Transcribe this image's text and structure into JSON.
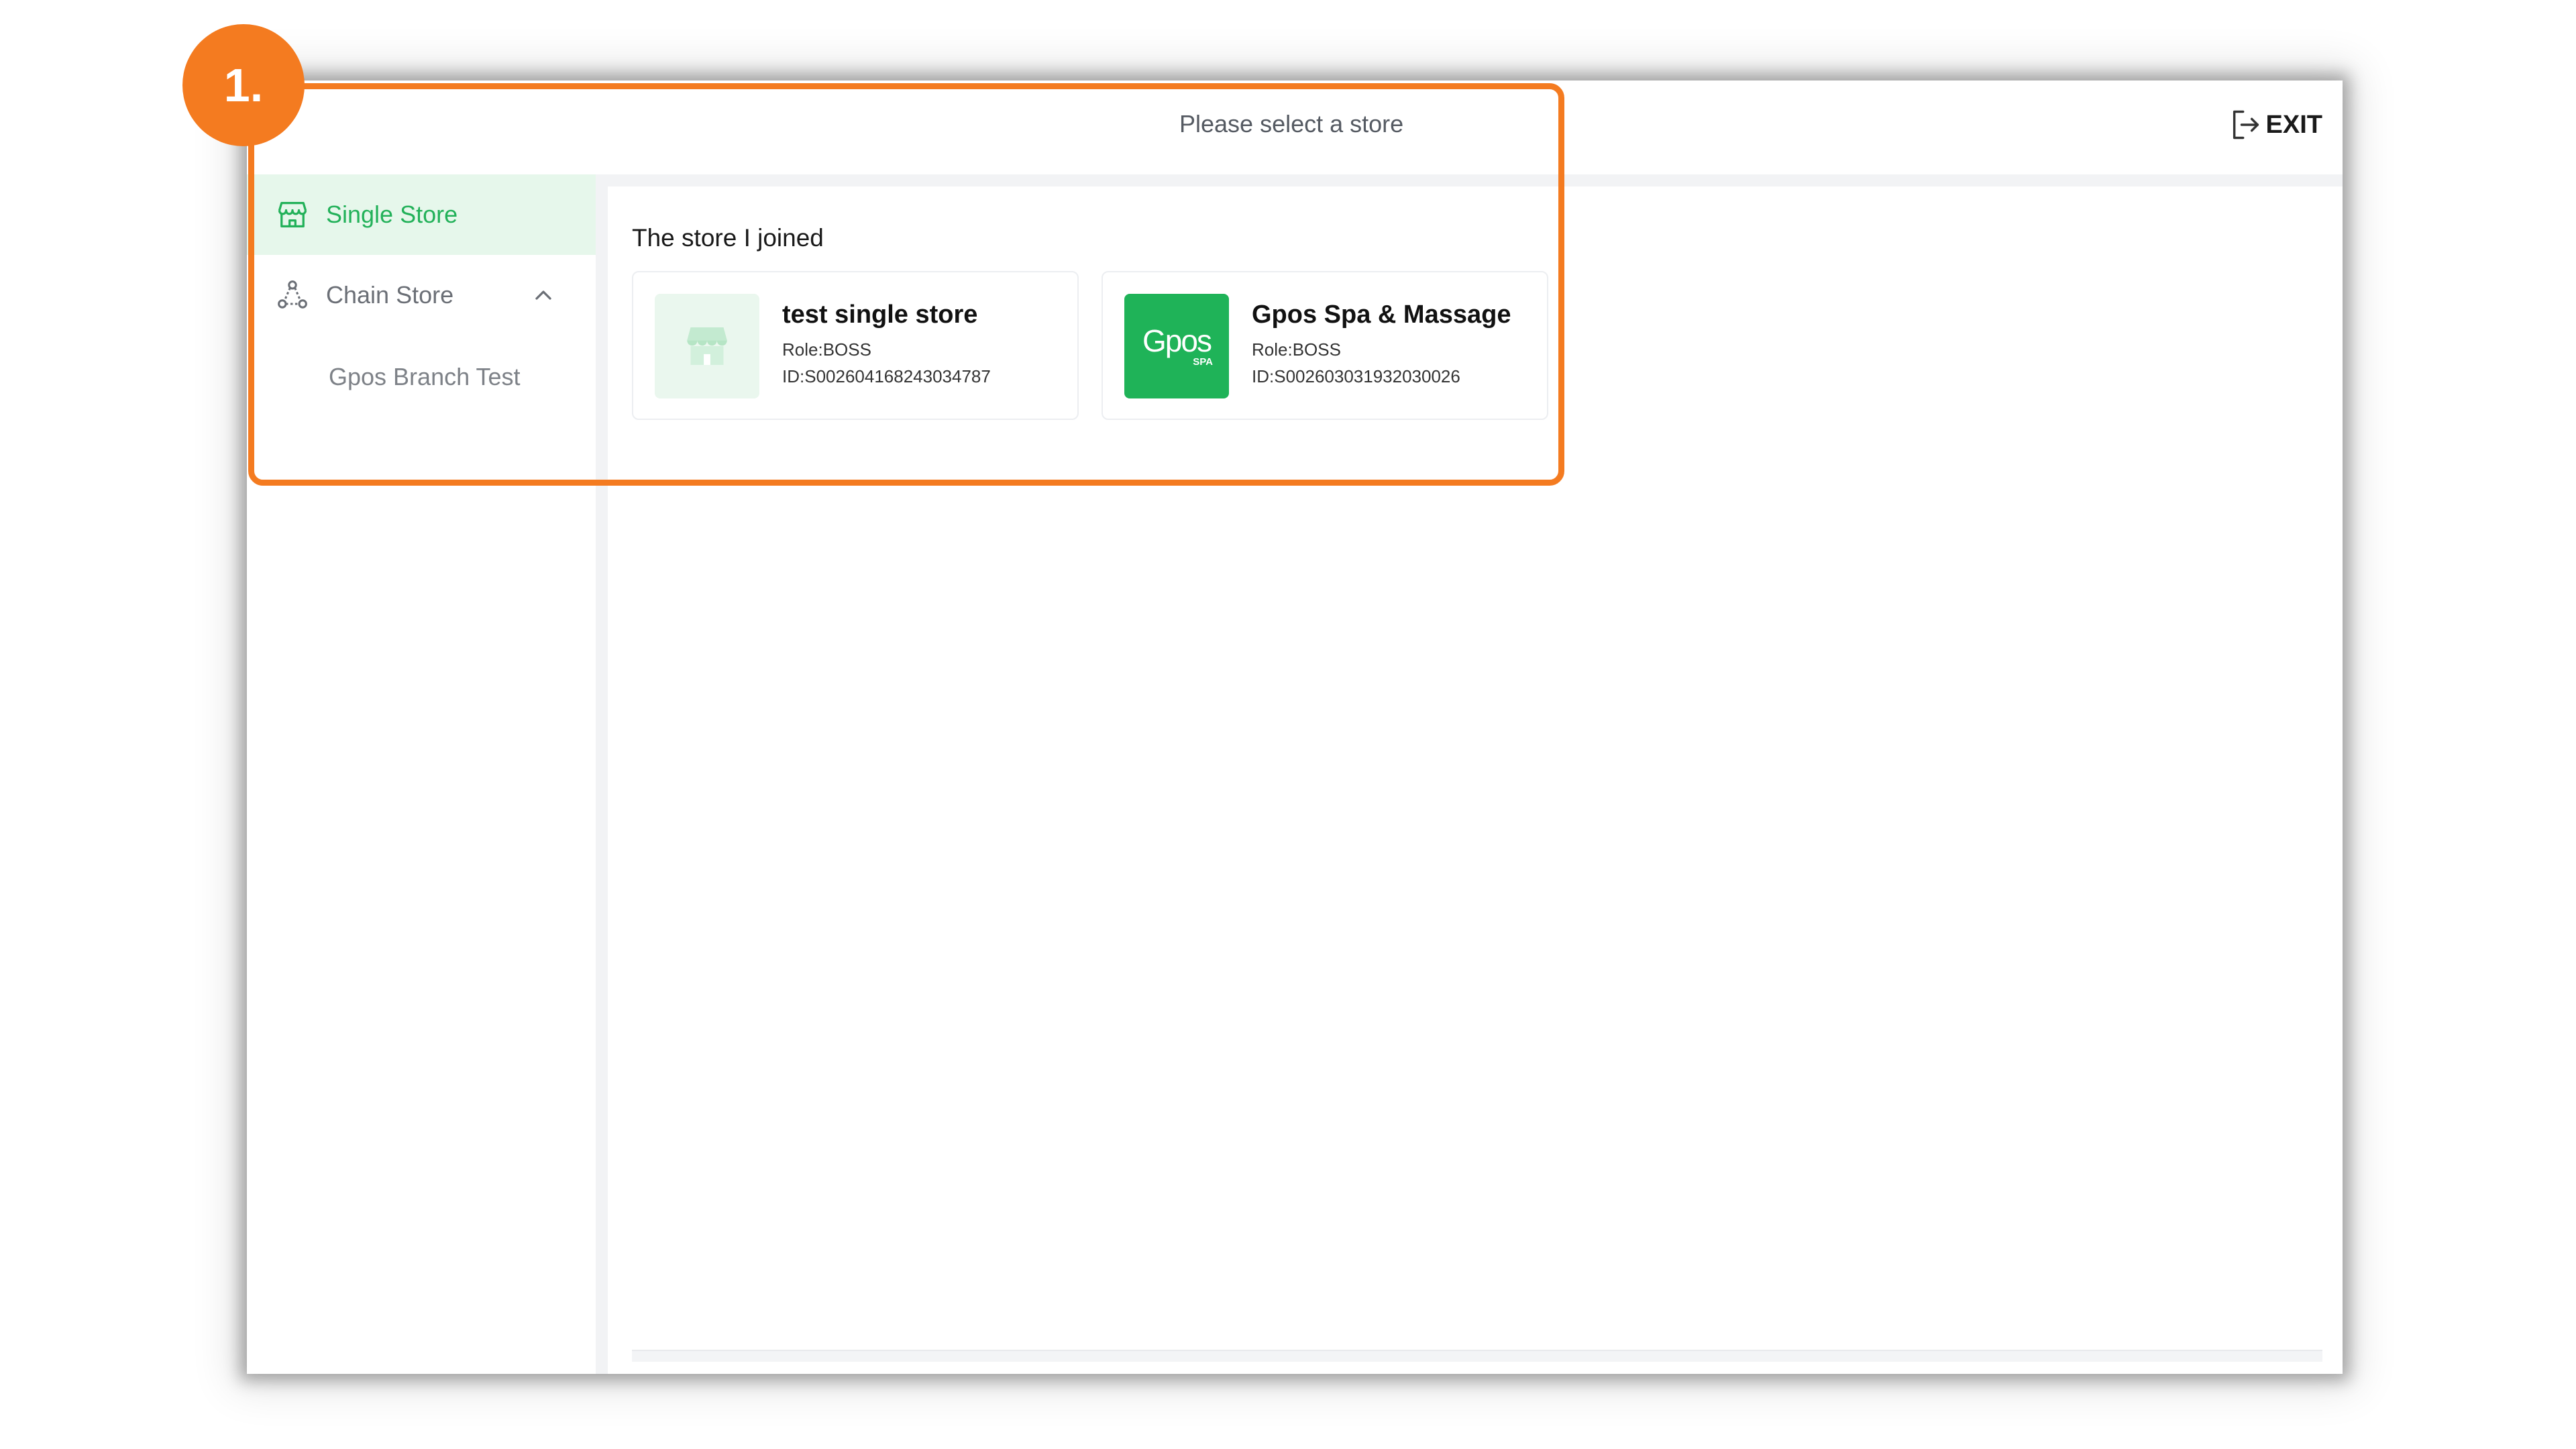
{
  "header": {
    "title": "Please select a store",
    "exit_label": "EXIT"
  },
  "sidebar": {
    "items": [
      {
        "label": "Single Store",
        "icon": "storefront-icon",
        "active": true
      },
      {
        "label": "Chain Store",
        "icon": "chain-network-icon",
        "expanded": true,
        "children": [
          {
            "label": "Gpos Branch Test"
          }
        ]
      }
    ]
  },
  "main": {
    "section_title": "The store I joined",
    "stores": [
      {
        "name": "test single store",
        "role": "Role:BOSS",
        "id": "ID:S002604168243034787",
        "thumbnail": "storefront-placeholder-icon"
      },
      {
        "name": "Gpos Spa & Massage",
        "role": "Role:BOSS",
        "id": "ID:S002603031932030026",
        "logo_text": "Gpos",
        "logo_sub": "SPA"
      }
    ]
  },
  "annotation": {
    "step_label": "1."
  },
  "colors": {
    "accent_green": "#22b159",
    "active_bg": "#e6f7eb",
    "highlight_orange": "#f47b20"
  }
}
